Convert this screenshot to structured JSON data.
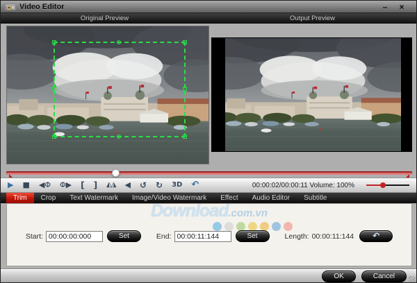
{
  "window": {
    "title": "Video Editor",
    "minimize": "–",
    "close": "×"
  },
  "previews": {
    "original": "Original Preview",
    "output": "Output Preview"
  },
  "transport": {
    "time": "00:00:02/00:00:11",
    "volume_label": "Volume:",
    "volume_value": "100%",
    "icons": [
      {
        "name": "play",
        "glyph": "▶"
      },
      {
        "name": "stop",
        "glyph": "■"
      },
      {
        "name": "step-backward",
        "glyph": "◀Φ"
      },
      {
        "name": "step-forward",
        "glyph": "Φ▶"
      },
      {
        "name": "mark-in",
        "glyph": "["
      },
      {
        "name": "mark-out",
        "glyph": "]"
      },
      {
        "name": "flip-horizontal",
        "glyph": "◭◮"
      },
      {
        "name": "flip-vertical",
        "glyph": "◀"
      },
      {
        "name": "rotate-left",
        "glyph": "↺"
      },
      {
        "name": "rotate-right",
        "glyph": "↻"
      },
      {
        "name": "three-d",
        "glyph": "3D"
      },
      {
        "name": "undo",
        "glyph": "↶"
      }
    ]
  },
  "tabs": [
    {
      "label": "Trim",
      "active": true
    },
    {
      "label": "Crop",
      "active": false
    },
    {
      "label": "Text Watermark",
      "active": false
    },
    {
      "label": "Image/Video Watermark",
      "active": false
    },
    {
      "label": "Effect",
      "active": false
    },
    {
      "label": "Audio Editor",
      "active": false
    },
    {
      "label": "Subtitle",
      "active": false
    }
  ],
  "trim_panel": {
    "start_label": "Start:",
    "start_value": "00:00:00:000",
    "set_label": "Set",
    "end_label": "End:",
    "end_value": "00:00:11:144",
    "length_label": "Length:",
    "length_value": "00:00:11:144",
    "undo_glyph": "↶"
  },
  "watermark": {
    "main": "Download",
    "suffix": ".com.vn",
    "dots": [
      "#7fc1e4",
      "#d9d9d5",
      "#b4d48e",
      "#eed168",
      "#efc368",
      "#8cb9dc",
      "#f2a8a1"
    ]
  },
  "footer": {
    "ok": "OK",
    "cancel": "Cancel"
  },
  "colors": {
    "active_tab_red": "#c01508",
    "timeline_red": "#c01818",
    "selection_green": "#28e047",
    "icon_blue": "#3f6fa0"
  }
}
